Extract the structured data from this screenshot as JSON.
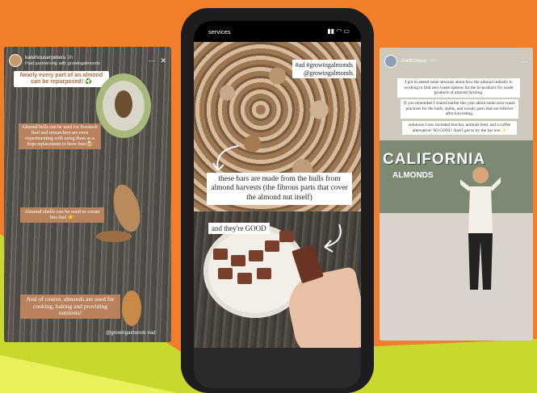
{
  "left_story": {
    "username": "katehouserpeters",
    "time": "3h",
    "subtitle": "Paid partnership with growingalmonds",
    "title_tag": "Nearly every part of an almond can be repurposed! ♻️",
    "caption_1": "Almond hulls can be used for livestock feed and researchers are even experimenting with using them as a hops replacement to brew beer🍺",
    "caption_2": "Almond shells can be used to create bio-fuel 👉",
    "caption_3": "And of course, almonds are used for cooking, baking and providing nutrients!",
    "mention": "@growingalmonds #ad"
  },
  "phone": {
    "status_label": "services",
    "tag_line_1": "#ad #growingalmonds",
    "tag_line_2": "@growingalmonds",
    "caption_main": "these bars are made from the hulls from almond harvests (the fibrous parts that cover the almond nut itself)",
    "caption_good": "and they're GOOD"
  },
  "right_story": {
    "username": "shelbizleee",
    "time": "46m",
    "caption_1": "I got to attend some sessions about how the almond industry is working to find zero waste options for the bi-products for waste products of almond farming.",
    "caption_2": "If you remember I shared earlier this year about some zero-waste practices for the hulls, shells, and woody parts that are leftover after harvesting.",
    "caption_3": "solutions I saw included biochar, animals feed, and a coffee alternative! SO COOL! And I got to try the bar one ✨",
    "van_text": "CALIFORNIA",
    "van_text_2": "ALMONDS"
  }
}
